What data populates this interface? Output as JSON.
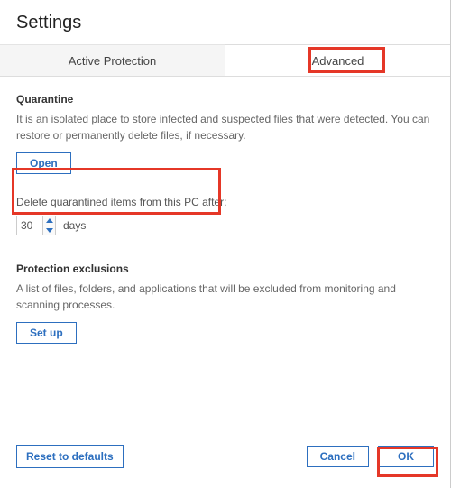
{
  "title": "Settings",
  "tabs": {
    "active_label": "Active Protection",
    "advanced_label": "Advanced"
  },
  "quarantine": {
    "title": "Quarantine",
    "desc": "It is an isolated place to store infected and suspected files that were detected. You can restore or permanently delete files, if necessary.",
    "open_btn": "Open",
    "delete_label": "Delete quarantined items from this PC after:",
    "days_value": "30",
    "days_unit": "days"
  },
  "exclusions": {
    "title": "Protection exclusions",
    "desc": "A list of files, folders, and applications that will be excluded from monitoring and scanning processes.",
    "setup_btn": "Set up"
  },
  "footer": {
    "reset": "Reset to defaults",
    "cancel": "Cancel",
    "ok": "OK"
  }
}
